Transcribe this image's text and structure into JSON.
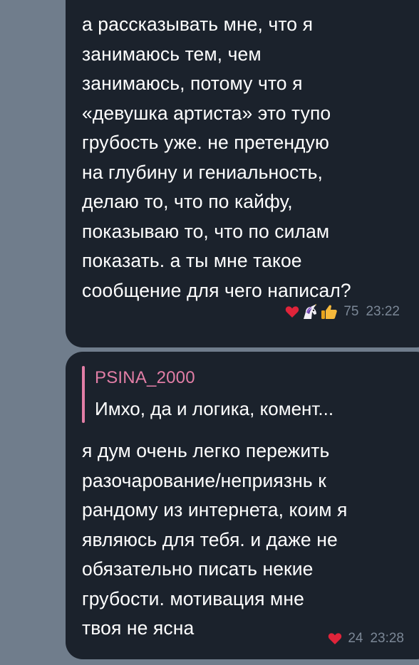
{
  "messages": [
    {
      "text": "а рассказывать мне, что я\nзанимаюсь тем, чем\nзанимаюсь, потому что я\n«девушка артиста» это тупо\nгрубость уже. не претендую\nна глубину и гениальность,\nделаю то, что по кайфу,\nпоказываю то, что по силам\nпоказать. а ты мне такое\nсообщение для чего написал?",
      "reactions": [
        "red-heart",
        "unicorn",
        "thumbs-up"
      ],
      "reaction_count": "75",
      "time": "23:22"
    },
    {
      "reply": {
        "author": "PSINA_2000",
        "snippet": "Имхо, да и логика, комент..."
      },
      "text": "я дум очень легко пережить\nразочарование/неприязнь к\nрандому из интернета, коим я\nявляюсь для тебя. и даже не\nобязательно писать некие\nгрубости. мотивация мне\nтвоя не ясна",
      "reactions": [
        "red-heart"
      ],
      "reaction_count": "24",
      "time": "23:28"
    }
  ],
  "colors": {
    "chat_background": "#707d8c",
    "bubble": "#1b222c",
    "reply_accent": "#e27ea6",
    "meta_text": "#7b8796"
  }
}
